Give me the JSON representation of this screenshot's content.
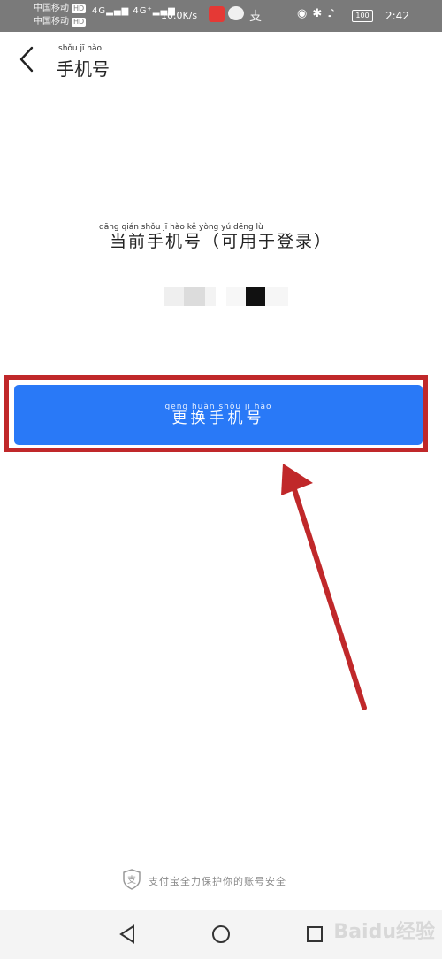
{
  "status_bar": {
    "carrier1": "中国移动",
    "carrier2": "中国移动",
    "hd": "HD",
    "network": "4G",
    "network2": "4G⁺",
    "speed": "10.0K/s",
    "battery": "100",
    "time": "2:42"
  },
  "header": {
    "title": "手机号",
    "title_pinyin": "shǒu  jī  hào"
  },
  "content": {
    "current_label": "当前手机号（可用于登录）",
    "current_label_pinyin": "dāng qián shǒu  jī  hào    kě  yòng yú dēng  lù"
  },
  "change_button": {
    "label": "更换手机号",
    "pinyin": "gēng huàn shǒu  jī  hào"
  },
  "footer": {
    "text": "支付宝全力保护你的账号安全"
  },
  "watermark": "Baidu经验",
  "colors": {
    "button": "#2979f7",
    "highlight": "#c0282a",
    "status_bar": "#7a7a7a"
  },
  "icons": [
    "back-arrow-icon",
    "shield-icon",
    "nav-back-icon",
    "nav-home-icon",
    "nav-recents-icon"
  ]
}
